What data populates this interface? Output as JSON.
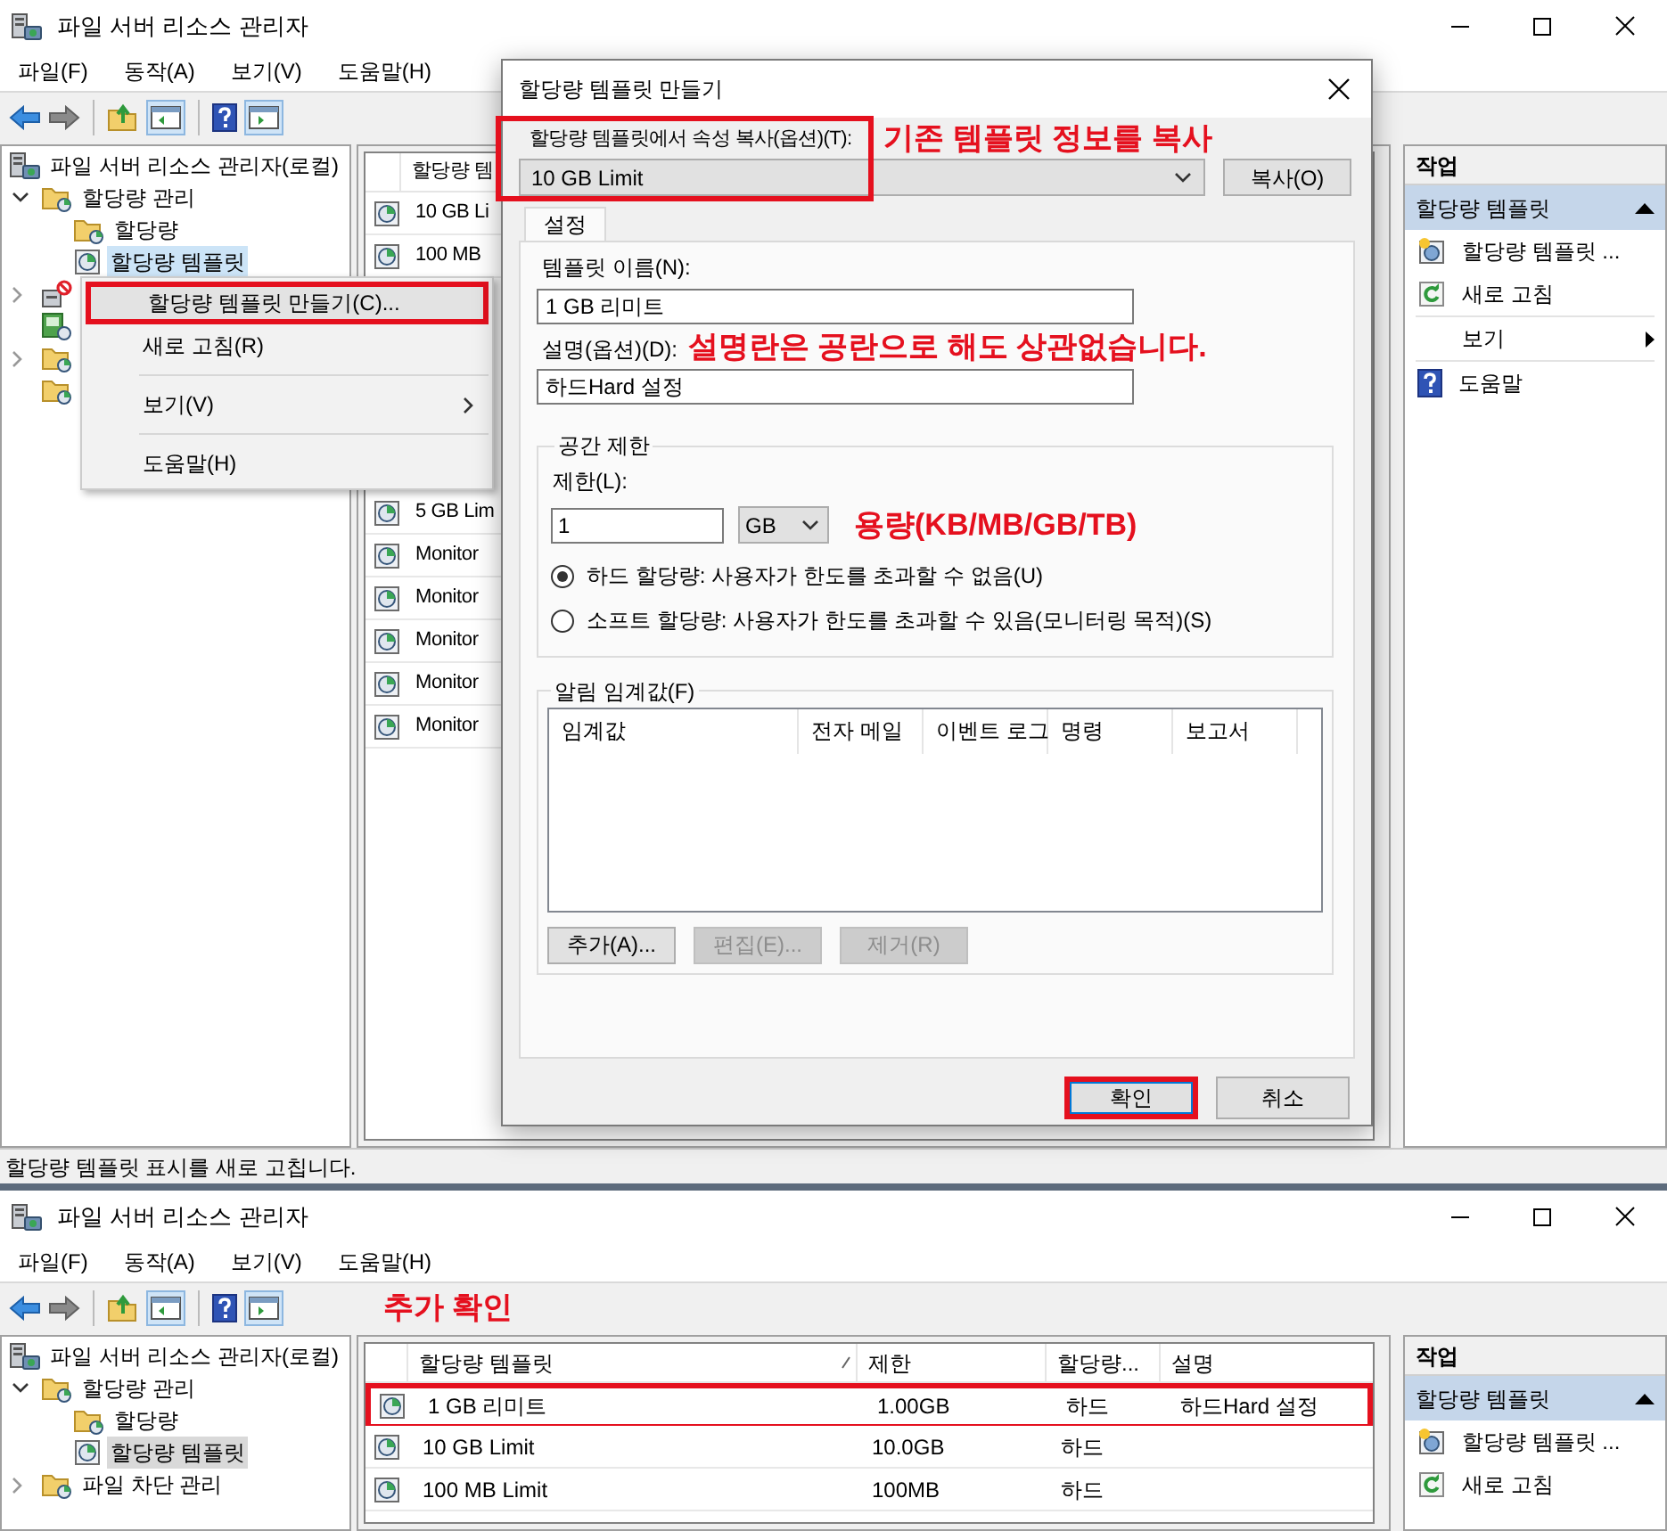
{
  "top_window": {
    "title": "파일 서버 리소스 관리자",
    "menu": [
      "파일(F)",
      "동작(A)",
      "보기(V)",
      "도움말(H)"
    ],
    "tree": [
      {
        "label": "파일 서버 리소스 관리자(로컬)",
        "selected": false,
        "children": [
          {
            "label": "할당량 관리",
            "expanded": true,
            "selected": false,
            "children": [
              {
                "label": "할당량",
                "selected": false
              },
              {
                "label": "할당량 템플릿",
                "selected": true
              }
            ]
          },
          {
            "kind": "covered",
            "expanded": false
          },
          {
            "kind": "covered"
          },
          {
            "kind": "covered",
            "expanded": false
          },
          {
            "kind": "covered"
          }
        ]
      }
    ],
    "list": {
      "column": "할당량 템",
      "rows": [
        {
          "name": "10 GB Li"
        },
        {
          "name": "100 MB"
        }
      ],
      "rows_below_menu": [
        {
          "name": "5 GB Lim"
        },
        {
          "name": "Monitor"
        },
        {
          "name": "Monitor"
        },
        {
          "name": "Monitor"
        },
        {
          "name": "Monitor"
        },
        {
          "name": "Monitor"
        }
      ]
    },
    "context_menu": [
      {
        "label": "할당량 템플릿 만들기(C)...",
        "highlighted": true
      },
      {
        "label": "새로 고침(R)",
        "highlighted": false
      },
      {
        "kind": "separator"
      },
      {
        "label": "보기(V)",
        "submenu": true,
        "highlighted": false
      },
      {
        "kind": "separator"
      },
      {
        "label": "도움말(H)",
        "highlighted": false
      }
    ],
    "actions": {
      "header": "작업",
      "section": "할당량 템플릿",
      "items": [
        {
          "label": "할당량 템플릿 ..."
        },
        {
          "label": "새로 고침"
        },
        {
          "kind": "separator"
        },
        {
          "label": "보기",
          "submenu": true
        },
        {
          "kind": "separator"
        },
        {
          "label": "도움말"
        }
      ]
    },
    "status_bar": "할당량 템플릿 표시를 새로 고칩니다."
  },
  "dialog": {
    "title": "할당량 템플릿 만들기",
    "copy_from": {
      "label": "할당량 템플릿에서 속성 복사(옵션)(T):",
      "value": "10 GB Limit",
      "button": "복사(O)",
      "highlighted": true,
      "note": "기존 템플릿 정보를 복사"
    },
    "tabs": [
      {
        "label": "설정",
        "selected": true
      }
    ],
    "name": {
      "label": "템플릿 이름(N):",
      "value": "1 GB 리미트"
    },
    "description": {
      "label": "설명(옵션)(D):",
      "value": "하드Hard 설정",
      "note": "설명란은 공란으로 해도 상관없습니다."
    },
    "space_limit": {
      "title": "공간 제한",
      "label": "제한(L):",
      "value": "1",
      "unit": "GB",
      "note": "용량(KB/MB/GB/TB)",
      "options": [
        {
          "label": "하드 할당량: 사용자가 한도를 초과할 수 없음(U)",
          "selected": true
        },
        {
          "label": "소프트 할당량: 사용자가 한도를 초과할 수 있음(모니터링 목적)(S)",
          "selected": false
        }
      ]
    },
    "thresholds": {
      "title": "알림 임계값(F)",
      "columns": [
        "임계값",
        "전자 메일",
        "이벤트 로그",
        "명령",
        "보고서"
      ],
      "buttons": [
        {
          "label": "추가(A)...",
          "disabled": false
        },
        {
          "label": "편집(E)...",
          "disabled": true
        },
        {
          "label": "제거(R)",
          "disabled": true
        }
      ]
    },
    "buttons": [
      {
        "label": "확인",
        "highlighted": true
      },
      {
        "label": "취소",
        "highlighted": false
      }
    ]
  },
  "bottom_window": {
    "title": "파일 서버 리소스 관리자",
    "menu": [
      "파일(F)",
      "동작(A)",
      "보기(V)",
      "도움말(H)"
    ],
    "note": "추가 확인",
    "tree": [
      {
        "label": "파일 서버 리소스 관리자(로컬)",
        "selected": false,
        "children": [
          {
            "label": "할당량 관리",
            "expanded": true,
            "selected": false,
            "children": [
              {
                "label": "할당량",
                "selected": false
              },
              {
                "label": "할당량 템플릿",
                "selected": true
              }
            ]
          },
          {
            "label": "파일 차단 관리",
            "expanded": false,
            "selected": false
          }
        ]
      }
    ],
    "table": {
      "columns": [
        {
          "label": "할당량 템플릿",
          "sorted": true
        },
        {
          "label": "제한",
          "sorted": false
        },
        {
          "label": "할당량...",
          "sorted": false
        },
        {
          "label": "설명",
          "sorted": false
        }
      ],
      "rows": [
        {
          "cells": [
            "1 GB 리미트",
            "1.00GB",
            "하드",
            "하드Hard 설정"
          ],
          "highlighted": true
        },
        {
          "cells": [
            "10 GB Limit",
            "10.0GB",
            "하드"
          ],
          "highlighted": false
        },
        {
          "cells": [
            "100 MB Limit",
            "100MB",
            "하드"
          ],
          "highlighted": false
        }
      ]
    },
    "actions": {
      "header": "작업",
      "section": "할당량 템플릿",
      "items": [
        {
          "label": "할당량 템플릿 ..."
        },
        {
          "label": "새로 고침"
        }
      ]
    }
  }
}
